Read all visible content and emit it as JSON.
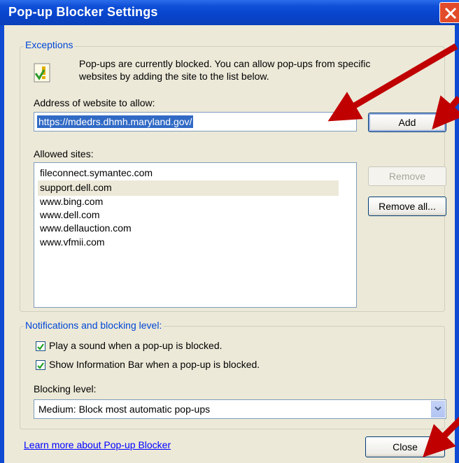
{
  "window": {
    "title": "Pop-up Blocker Settings"
  },
  "exceptions": {
    "legend": "Exceptions",
    "info_line1": "Pop-ups are currently blocked.  You can allow pop-ups from specific",
    "info_line2": "websites by adding the site to the list below.",
    "address_label": "Address of website to allow:",
    "address_value": "https://mdedrs.dhmh.maryland.gov/",
    "add_label": "Add",
    "allowed_label": "Allowed sites:",
    "allowed_sites": [
      "fileconnect.symantec.com",
      "support.dell.com",
      "www.bing.com",
      "www.dell.com",
      "www.dellauction.com",
      "www.vfmii.com"
    ],
    "remove_label": "Remove",
    "remove_all_label": "Remove all..."
  },
  "notifications": {
    "legend": "Notifications and blocking level:",
    "play_sound_label": "Play a sound when a pop-up is blocked.",
    "play_sound_checked": true,
    "info_bar_label": "Show Information Bar when a pop-up is blocked.",
    "info_bar_checked": true,
    "blocking_level_label": "Blocking level:",
    "blocking_level_value": "Medium: Block most automatic pop-ups"
  },
  "footer": {
    "learn_more": "Learn more about Pop-up Blocker",
    "close_label": "Close"
  },
  "colors": {
    "title_bar": "#0a46d0",
    "legend_text": "#0046d5",
    "annotation_arrow": "#c00000"
  }
}
